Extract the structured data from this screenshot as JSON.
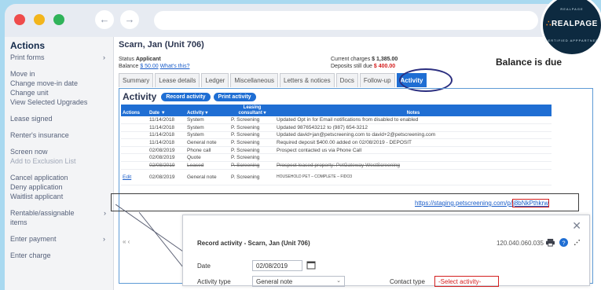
{
  "window_controls": {
    "red": "#ef4c4c",
    "yellow": "#f2b51c",
    "green": "#2fb35a"
  },
  "nav": {
    "back": "←",
    "forward": "→"
  },
  "sidebar": {
    "title": "Actions",
    "items": [
      {
        "label": "Print forms",
        "arrow": "›"
      },
      {
        "label": "Move in"
      },
      {
        "label": "Change move-in date"
      },
      {
        "label": "Change unit"
      },
      {
        "label": "View Selected Upgrades"
      },
      {
        "label": "Lease signed"
      },
      {
        "label": "Renter's insurance"
      },
      {
        "label": "Screen now"
      },
      {
        "label": "Add to Exclusion List"
      },
      {
        "label": "Cancel application"
      },
      {
        "label": "Deny application"
      },
      {
        "label": "Waitlist applicant"
      },
      {
        "label": "Rentable/assignable items",
        "arrow": "›"
      },
      {
        "label": "Enter payment",
        "arrow": "›"
      },
      {
        "label": "Enter charge"
      }
    ]
  },
  "header": {
    "name": "Scarn, Jan (Unit 706)",
    "status_label": "Status",
    "status_value": "Applicant",
    "balance_label": "Balance",
    "balance_value": "$ 50.00",
    "whats_this": "What's this?",
    "current_charges_label": "Current charges",
    "current_charges_value": "$ 1,385.00",
    "deposits_label": "Deposits still due",
    "deposits_value": "$ 400.00",
    "balance_due": "Balance is due"
  },
  "tabs": [
    "Summary",
    "Lease details",
    "Ledger",
    "Miscellaneous",
    "Letters & notices",
    "Docs",
    "Follow-up",
    "Activity"
  ],
  "active_tab": "Activity",
  "activity": {
    "title": "Activity",
    "record_button": "Record activity",
    "print_button": "Print activity",
    "columns": [
      "Actions",
      "Date",
      "Activity",
      "Leasing consultant",
      "Notes"
    ],
    "rows": [
      {
        "action": "",
        "date": "11/14/2018",
        "activity": "System",
        "consultant": "P. Screening",
        "notes": "Updated Opt in for Email notifications from disabled to enabled"
      },
      {
        "action": "",
        "date": "11/14/2018",
        "activity": "System",
        "consultant": "P. Screening",
        "notes": "Updated 9876543212 to (987) 654-3212"
      },
      {
        "action": "",
        "date": "11/14/2018",
        "activity": "System",
        "consultant": "P. Screening",
        "notes": "Updated david+jan@petscreening.com to david+2@petscreening.com"
      },
      {
        "action": "",
        "date": "11/14/2018",
        "activity": "General note",
        "consultant": "P. Screening",
        "notes": "Required deposit $400.00 added on 02/08/2019 - DEPOSIT"
      },
      {
        "action": "",
        "date": "02/08/2019",
        "activity": "Phone call",
        "consultant": "P. Screening",
        "notes": "Prospect contacted us via Phone Call"
      },
      {
        "action": "",
        "date": "02/08/2019",
        "activity": "Quote",
        "consultant": "P. Screening",
        "notes": ""
      },
      {
        "action": "",
        "date": "02/08/2019",
        "activity": "Leased",
        "consultant": "P. Screening",
        "notes": "Prospect leased property: PetGateway WestScreening"
      },
      {
        "action": "Edit",
        "date": "02/08/2019",
        "activity": "General note",
        "consultant": "P. Screening",
        "notes": "HOUSEHOLD PET – COMPLETE – FIDO3"
      }
    ],
    "url_prefix": "https://staging.petscreening.com/p/",
    "url_highlight": "j8bNkPthkrw",
    "pager": "« ‹"
  },
  "modal": {
    "close": "✕",
    "title": "Record activity -",
    "resident": "Scarn, Jan (Unit 706)",
    "record_id": "120.040.060.035",
    "date_label": "Date",
    "date_value": "02/08/2019",
    "activity_type_label": "Activity type",
    "activity_type_value": "General note",
    "contact_type_label": "Contact type",
    "contact_type_value": "-Select activity-"
  },
  "badge": {
    "brand": "REALPAGE",
    "ring_top": "REALPAGE",
    "ring_bottom": "CERTIFIED APPPARTNER"
  }
}
